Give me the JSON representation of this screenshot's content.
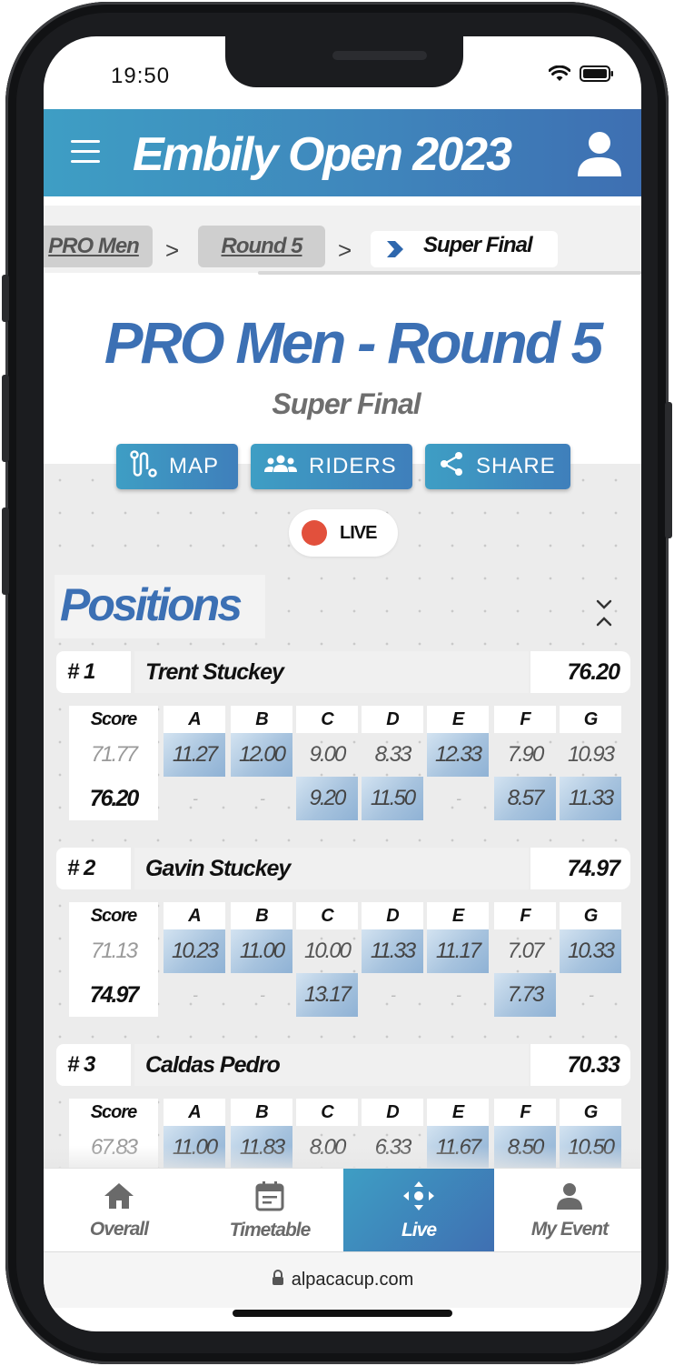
{
  "status": {
    "time": "19:50"
  },
  "header": {
    "title": "Embily Open 2023"
  },
  "breadcrumb": {
    "items": [
      "PRO Men",
      "Round 5"
    ],
    "separator": ">",
    "current": "Super Final"
  },
  "page": {
    "title": "PRO Men - Round 5",
    "subtitle": "Super Final"
  },
  "actions": {
    "map": "MAP",
    "riders": "RIDERS",
    "share": "SHARE"
  },
  "live": {
    "label": "LIVE"
  },
  "positions": {
    "title": "Positions",
    "columns": [
      "Score",
      "A",
      "B",
      "C",
      "D",
      "E",
      "F",
      "G"
    ],
    "riders": [
      {
        "rank": "# 1",
        "name": "Trent Stuckey",
        "total": "76.20",
        "prev_score": "71.77",
        "score": "76.20",
        "row1": [
          "11.27",
          "12.00",
          "9.00",
          "8.33",
          "12.33",
          "7.90",
          "10.93"
        ],
        "row2": [
          "-",
          "-",
          "9.20",
          "11.50",
          "-",
          "8.57",
          "11.33"
        ]
      },
      {
        "rank": "# 2",
        "name": "Gavin Stuckey",
        "total": "74.97",
        "prev_score": "71.13",
        "score": "74.97",
        "row1": [
          "10.23",
          "11.00",
          "10.00",
          "11.33",
          "11.17",
          "7.07",
          "10.33"
        ],
        "row2": [
          "-",
          "-",
          "13.17",
          "-",
          "-",
          "7.73",
          "-"
        ]
      },
      {
        "rank": "# 3",
        "name": "Caldas Pedro",
        "total": "70.33",
        "prev_score": "67.83",
        "score": "",
        "row1": [
          "11.00",
          "11.83",
          "8.00",
          "6.33",
          "11.67",
          "8.50",
          "10.50"
        ],
        "row2": []
      }
    ]
  },
  "nav": {
    "items": [
      "Overall",
      "Timetable",
      "Live",
      "My Event"
    ],
    "active": "Live"
  },
  "browser": {
    "url": "alpacacup.com"
  },
  "colors": {
    "brand_blue": "#3c70b4",
    "header_gradient_start": "#3e9ec4",
    "live_red": "#e2503c"
  }
}
